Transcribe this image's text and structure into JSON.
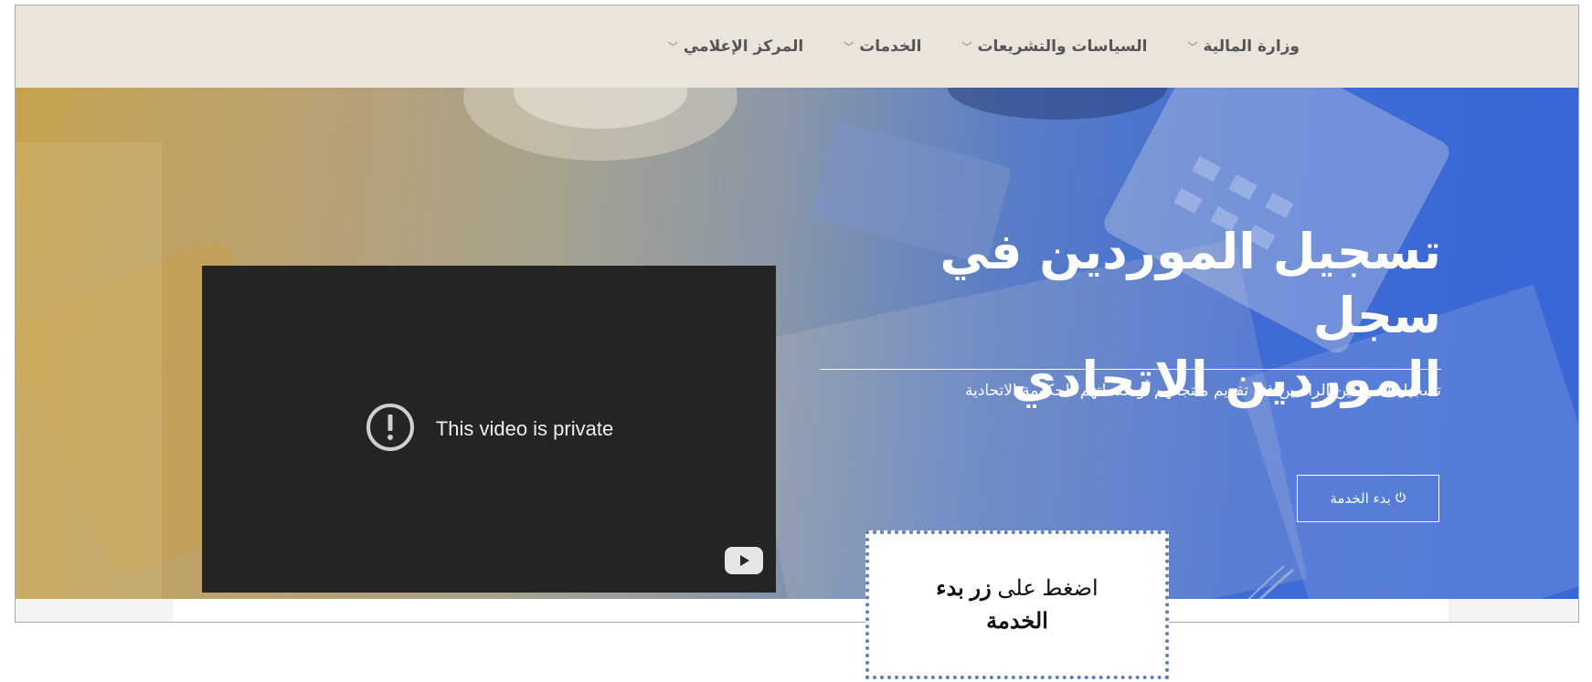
{
  "nav": {
    "items": [
      {
        "label": "وزارة المالية"
      },
      {
        "label": "السياسات والتشريعات"
      },
      {
        "label": "الخدمات"
      },
      {
        "label": "المركز الإعلامي"
      }
    ]
  },
  "hero": {
    "title_line1": "تسجيل الموردين في سجل",
    "title_line2": "الموردين الاتحادي",
    "subtitle": "تسجيل الموردين الراغبين في تقديم منتجاتهم أو خدماتهم للحكومة الاتحادية",
    "start_button": "بدء الخدمة"
  },
  "video": {
    "message": "This video is private"
  },
  "callout": {
    "text_normal": "اضغط على ",
    "text_bold_1": "زر بدء",
    "text_bold_2": "الخدمة"
  },
  "colors": {
    "nav_bg": "#ebe4db",
    "hero_gold": "#c6a24e",
    "hero_blue": "#3a66d7",
    "callout_border": "#5b7fb9"
  },
  "icons": {
    "nav_chevron": "chevron-down-icon",
    "start_button": "power-icon",
    "video_error": "exclamation-circle-icon",
    "video_logo": "youtube-play-icon",
    "annotation": "arrow-pointer-icon"
  }
}
